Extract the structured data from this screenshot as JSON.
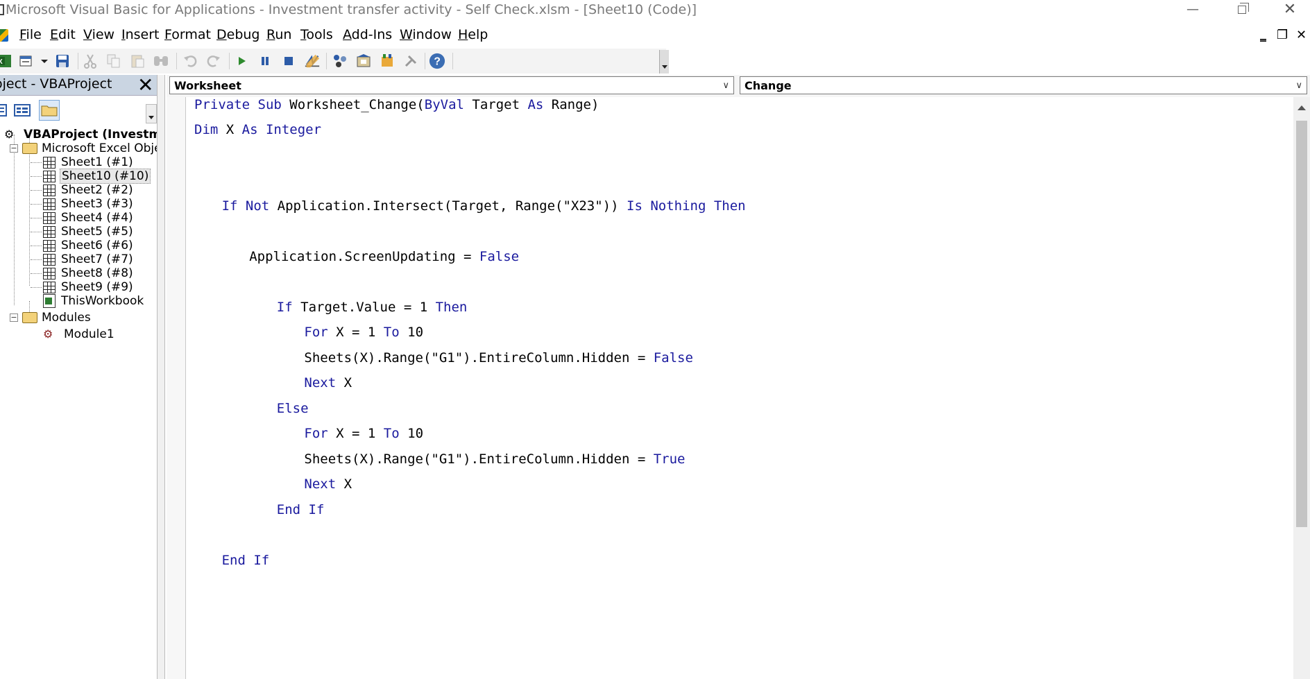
{
  "window": {
    "title": "Microsoft Visual Basic for Applications - Investment transfer activity - Self Check.xlsm - [Sheet10 (Code)]",
    "minimize": "—",
    "close": "✕"
  },
  "menu": {
    "items": [
      {
        "label": "File",
        "ul": "F",
        "rest": "ile"
      },
      {
        "label": "Edit",
        "ul": "E",
        "rest": "dit"
      },
      {
        "label": "View",
        "ul": "V",
        "rest": "iew"
      },
      {
        "label": "Insert",
        "ul": "I",
        "rest": "nsert"
      },
      {
        "label": "Format",
        "ul": "F",
        "rest": "ormat"
      },
      {
        "label": "Debug",
        "ul": "D",
        "rest": "ebug"
      },
      {
        "label": "Run",
        "ul": "R",
        "rest": "un"
      },
      {
        "label": "Tools",
        "ul": "T",
        "rest": "ools"
      },
      {
        "label": "Add-Ins",
        "ul": "A",
        "rest": "dd-Ins"
      },
      {
        "label": "Window",
        "ul": "W",
        "rest": "indow"
      },
      {
        "label": "Help",
        "ul": "H",
        "rest": "elp"
      }
    ],
    "mdi_minimize": "‗",
    "mdi_restore": "❐",
    "mdi_close": "✕"
  },
  "toolbar": {
    "icons": [
      "excel-icon",
      "insert-userform-icon",
      "save-icon",
      "cut-icon",
      "copy-icon",
      "paste-icon",
      "find-icon",
      "undo-icon",
      "redo-icon",
      "run-icon",
      "break-icon",
      "reset-icon",
      "design-mode-icon",
      "project-explorer-icon",
      "properties-window-icon",
      "object-browser-icon",
      "toolbox-icon",
      "help-icon"
    ]
  },
  "project": {
    "title": "oject - VBAProject",
    "close": "✕",
    "tree": {
      "root": "VBAProject (Investmen",
      "excel_objects": "Microsoft Excel Objects",
      "sheets": [
        "Sheet1 (#1)",
        "Sheet10 (#10)",
        "Sheet2 (#2)",
        "Sheet3 (#3)",
        "Sheet4 (#4)",
        "Sheet5 (#5)",
        "Sheet6 (#6)",
        "Sheet7 (#7)",
        "Sheet8 (#8)",
        "Sheet9 (#9)"
      ],
      "selected_sheet": "Sheet10 (#10)",
      "workbook": "ThisWorkbook",
      "modules": "Modules",
      "module1": "Module1"
    }
  },
  "code": {
    "object_combo": "Worksheet",
    "procedure_combo": "Change",
    "lines": [
      {
        "indent": 0,
        "parts": [
          [
            "k",
            "Private Sub"
          ],
          [
            "t",
            " Worksheet_Change("
          ],
          [
            "k",
            "ByVal"
          ],
          [
            "t",
            " Target "
          ],
          [
            "k",
            "As"
          ],
          [
            "t",
            " Range)"
          ]
        ]
      },
      {
        "indent": 0,
        "parts": [
          [
            "k",
            "Dim"
          ],
          [
            "t",
            " X "
          ],
          [
            "k",
            "As Integer"
          ]
        ]
      },
      {
        "indent": 4,
        "parts": [
          [
            "k",
            "If Not"
          ],
          [
            "t",
            " Application.Intersect(Target, Range(\"X23\")) "
          ],
          [
            "k",
            "Is Nothing Then"
          ]
        ]
      },
      {
        "indent": 8,
        "parts": [
          [
            "t",
            "Application.ScreenUpdating = "
          ],
          [
            "k",
            "False"
          ]
        ]
      },
      {
        "indent": 12,
        "parts": [
          [
            "k",
            "If"
          ],
          [
            "t",
            " Target.Value = 1 "
          ],
          [
            "k",
            "Then"
          ]
        ]
      },
      {
        "indent": 16,
        "parts": [
          [
            "k",
            "For"
          ],
          [
            "t",
            " X = 1 "
          ],
          [
            "k",
            "To"
          ],
          [
            "t",
            " 10"
          ]
        ]
      },
      {
        "indent": 16,
        "parts": [
          [
            "t",
            "Sheets(X).Range(\"G1\").EntireColumn.Hidden = "
          ],
          [
            "k",
            "False"
          ]
        ]
      },
      {
        "indent": 16,
        "parts": [
          [
            "k",
            "Next"
          ],
          [
            "t",
            " X"
          ]
        ]
      },
      {
        "indent": 12,
        "parts": [
          [
            "k",
            "Else"
          ]
        ]
      },
      {
        "indent": 16,
        "parts": [
          [
            "k",
            "For"
          ],
          [
            "t",
            " X = 1 "
          ],
          [
            "k",
            "To"
          ],
          [
            "t",
            " 10"
          ]
        ]
      },
      {
        "indent": 16,
        "parts": [
          [
            "t",
            "Sheets(X).Range(\"G1\").EntireColumn.Hidden = "
          ],
          [
            "k",
            "True"
          ]
        ]
      },
      {
        "indent": 16,
        "parts": [
          [
            "k",
            "Next"
          ],
          [
            "t",
            " X"
          ]
        ]
      },
      {
        "indent": 12,
        "parts": [
          [
            "k",
            "End If"
          ]
        ]
      },
      {
        "indent": 4,
        "parts": [
          [
            "k",
            "End If"
          ]
        ]
      }
    ]
  }
}
